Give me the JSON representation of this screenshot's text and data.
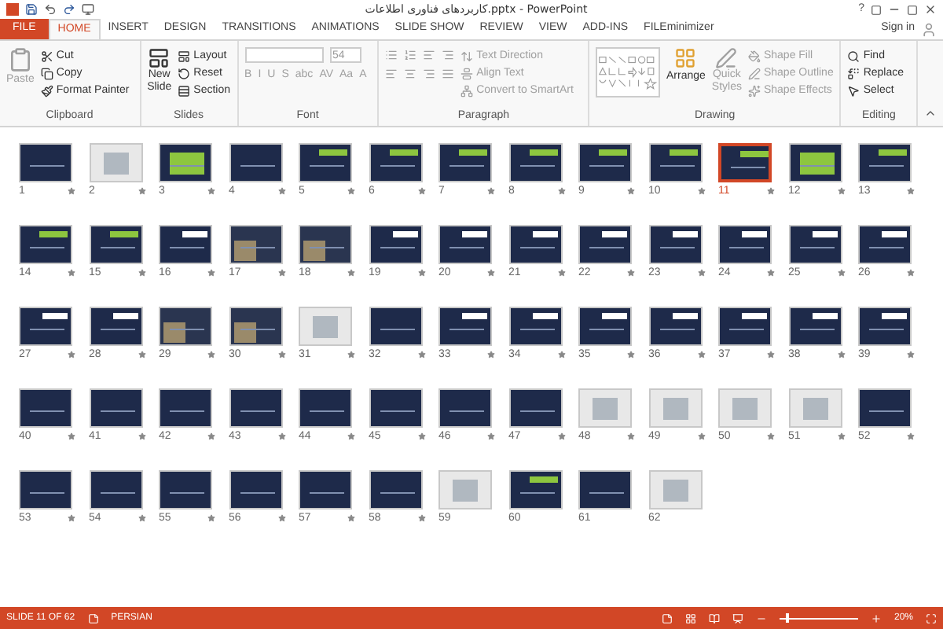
{
  "window": {
    "title": "کاربردهای فناوری اطلاعات.pptx - PowerPoint",
    "help": "?",
    "sign_in": "Sign in"
  },
  "tabs": [
    {
      "label": "FILE",
      "kind": "file",
      "selected": false
    },
    {
      "label": "HOME",
      "kind": "tab",
      "selected": true
    },
    {
      "label": "INSERT",
      "kind": "tab",
      "selected": false
    },
    {
      "label": "DESIGN",
      "kind": "tab",
      "selected": false
    },
    {
      "label": "TRANSITIONS",
      "kind": "tab",
      "selected": false
    },
    {
      "label": "ANIMATIONS",
      "kind": "tab",
      "selected": false
    },
    {
      "label": "SLIDE SHOW",
      "kind": "tab",
      "selected": false
    },
    {
      "label": "REVIEW",
      "kind": "tab",
      "selected": false
    },
    {
      "label": "VIEW",
      "kind": "tab",
      "selected": false
    },
    {
      "label": "ADD-INS",
      "kind": "tab",
      "selected": false
    },
    {
      "label": "FILEminimizer",
      "kind": "tab",
      "selected": false
    }
  ],
  "ribbon": {
    "clipboard": {
      "label": "Clipboard",
      "paste": {
        "label": "Paste",
        "disabled": true
      },
      "cut": {
        "label": "Cut",
        "disabled": false
      },
      "copy": {
        "label": "Copy",
        "disabled": false
      },
      "format_painter": {
        "label": "Format Painter",
        "disabled": false
      }
    },
    "slides": {
      "label": "Slides",
      "new_slide": "New Slide",
      "layout": "Layout",
      "reset": "Reset",
      "section": "Section"
    },
    "font": {
      "label": "Font",
      "size": "54",
      "buttons": [
        "B",
        "I",
        "U",
        "S",
        "abc",
        "AV",
        "Aa",
        "A"
      ]
    },
    "paragraph": {
      "label": "Paragraph",
      "text_direction": "Text Direction",
      "align_text": "Align Text",
      "convert": "Convert to SmartArt"
    },
    "drawing": {
      "label": "Drawing",
      "arrange": "Arrange",
      "quick_styles": "Quick Styles",
      "shape_fill": "Shape Fill",
      "shape_outline": "Shape Outline",
      "shape_effects": "Shape Effects"
    },
    "editing": {
      "label": "Editing",
      "find": "Find",
      "replace": "Replace",
      "select": "Select"
    }
  },
  "slides": [
    {
      "number": "1",
      "kind": "dark",
      "selected": false,
      "animated": true
    },
    {
      "number": "2",
      "kind": "light",
      "selected": false,
      "animated": true
    },
    {
      "number": "3",
      "kind": "table",
      "selected": false,
      "animated": true
    },
    {
      "number": "4",
      "kind": "dark",
      "selected": false,
      "animated": true
    },
    {
      "number": "5",
      "kind": "green",
      "selected": false,
      "animated": true
    },
    {
      "number": "6",
      "kind": "green",
      "selected": false,
      "animated": true
    },
    {
      "number": "7",
      "kind": "green",
      "selected": false,
      "animated": true
    },
    {
      "number": "8",
      "kind": "green",
      "selected": false,
      "animated": true
    },
    {
      "number": "9",
      "kind": "green",
      "selected": false,
      "animated": true
    },
    {
      "number": "10",
      "kind": "green",
      "selected": false,
      "animated": true
    },
    {
      "number": "11",
      "kind": "green",
      "selected": true,
      "animated": true
    },
    {
      "number": "12",
      "kind": "table",
      "selected": false,
      "animated": true
    },
    {
      "number": "13",
      "kind": "green",
      "selected": false,
      "animated": true
    },
    {
      "number": "14",
      "kind": "green",
      "selected": false,
      "animated": true
    },
    {
      "number": "15",
      "kind": "green",
      "selected": false,
      "animated": true
    },
    {
      "number": "16",
      "kind": "white",
      "selected": false,
      "animated": true
    },
    {
      "number": "17",
      "kind": "photo",
      "selected": false,
      "animated": true
    },
    {
      "number": "18",
      "kind": "photo",
      "selected": false,
      "animated": true
    },
    {
      "number": "19",
      "kind": "white",
      "selected": false,
      "animated": true
    },
    {
      "number": "20",
      "kind": "white",
      "selected": false,
      "animated": true
    },
    {
      "number": "21",
      "kind": "white",
      "selected": false,
      "animated": true
    },
    {
      "number": "22",
      "kind": "white",
      "selected": false,
      "animated": true
    },
    {
      "number": "23",
      "kind": "white",
      "selected": false,
      "animated": true
    },
    {
      "number": "24",
      "kind": "white",
      "selected": false,
      "animated": true
    },
    {
      "number": "25",
      "kind": "white",
      "selected": false,
      "animated": true
    },
    {
      "number": "26",
      "kind": "white",
      "selected": false,
      "animated": true
    },
    {
      "number": "27",
      "kind": "white",
      "selected": false,
      "animated": true
    },
    {
      "number": "28",
      "kind": "white",
      "selected": false,
      "animated": true
    },
    {
      "number": "29",
      "kind": "photo",
      "selected": false,
      "animated": true
    },
    {
      "number": "30",
      "kind": "photo",
      "selected": false,
      "animated": true
    },
    {
      "number": "31",
      "kind": "light",
      "selected": false,
      "animated": true
    },
    {
      "number": "32",
      "kind": "dark",
      "selected": false,
      "animated": true
    },
    {
      "number": "33",
      "kind": "white",
      "selected": false,
      "animated": true
    },
    {
      "number": "34",
      "kind": "white",
      "selected": false,
      "animated": true
    },
    {
      "number": "35",
      "kind": "white",
      "selected": false,
      "animated": true
    },
    {
      "number": "36",
      "kind": "white",
      "selected": false,
      "animated": true
    },
    {
      "number": "37",
      "kind": "white",
      "selected": false,
      "animated": true
    },
    {
      "number": "38",
      "kind": "white",
      "selected": false,
      "animated": true
    },
    {
      "number": "39",
      "kind": "white",
      "selected": false,
      "animated": true
    },
    {
      "number": "40",
      "kind": "dark",
      "selected": false,
      "animated": true
    },
    {
      "number": "41",
      "kind": "dark",
      "selected": false,
      "animated": true
    },
    {
      "number": "42",
      "kind": "dark",
      "selected": false,
      "animated": true
    },
    {
      "number": "43",
      "kind": "dark",
      "selected": false,
      "animated": true
    },
    {
      "number": "44",
      "kind": "dark",
      "selected": false,
      "animated": true
    },
    {
      "number": "45",
      "kind": "dark",
      "selected": false,
      "animated": true
    },
    {
      "number": "46",
      "kind": "dark",
      "selected": false,
      "animated": true
    },
    {
      "number": "47",
      "kind": "dark",
      "selected": false,
      "animated": true
    },
    {
      "number": "48",
      "kind": "light",
      "selected": false,
      "animated": true
    },
    {
      "number": "49",
      "kind": "light",
      "selected": false,
      "animated": true
    },
    {
      "number": "50",
      "kind": "light",
      "selected": false,
      "animated": true
    },
    {
      "number": "51",
      "kind": "light",
      "selected": false,
      "animated": true
    },
    {
      "number": "52",
      "kind": "dark",
      "selected": false,
      "animated": true
    },
    {
      "number": "53",
      "kind": "dark",
      "selected": false,
      "animated": true
    },
    {
      "number": "54",
      "kind": "dark",
      "selected": false,
      "animated": true
    },
    {
      "number": "55",
      "kind": "dark",
      "selected": false,
      "animated": true
    },
    {
      "number": "56",
      "kind": "dark",
      "selected": false,
      "animated": true
    },
    {
      "number": "57",
      "kind": "dark",
      "selected": false,
      "animated": true
    },
    {
      "number": "58",
      "kind": "dark",
      "selected": false,
      "animated": true
    },
    {
      "number": "59",
      "kind": "light",
      "selected": false,
      "animated": false
    },
    {
      "number": "60",
      "kind": "green",
      "selected": false,
      "animated": false
    },
    {
      "number": "61",
      "kind": "dark",
      "selected": false,
      "animated": false
    },
    {
      "number": "62",
      "kind": "light",
      "selected": false,
      "animated": false
    }
  ],
  "status_bar": {
    "slide": "SLIDE 11 OF 62",
    "language": "PERSIAN",
    "zoom": "20%",
    "zoom_level": {
      "level": 0.08
    }
  }
}
